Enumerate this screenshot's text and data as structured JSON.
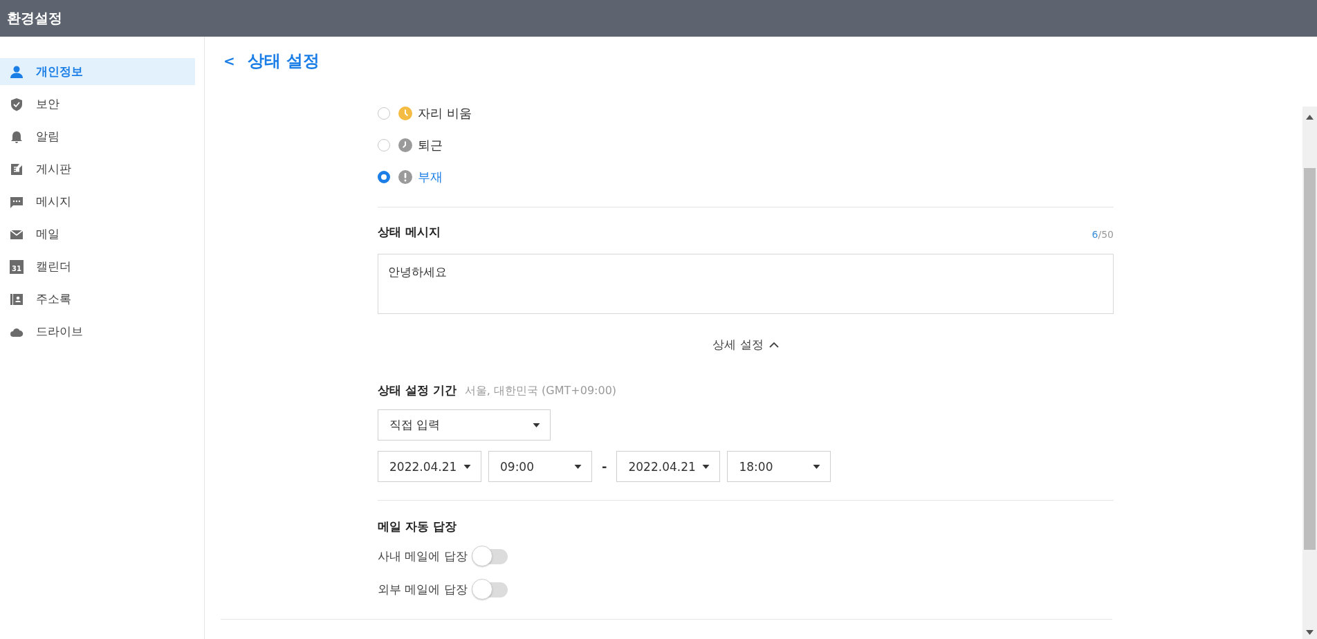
{
  "header": {
    "title": "환경설정"
  },
  "sidebar": {
    "items": [
      {
        "kind": "person",
        "label": "개인정보",
        "selected": true
      },
      {
        "kind": "shield",
        "label": "보안",
        "selected": false
      },
      {
        "kind": "bell",
        "label": "알림",
        "selected": false
      },
      {
        "kind": "board",
        "label": "게시판",
        "selected": false
      },
      {
        "kind": "chat",
        "label": "메시지",
        "selected": false
      },
      {
        "kind": "mail",
        "label": "메일",
        "selected": false
      },
      {
        "kind": "calendar",
        "label": "캘린더",
        "selected": false,
        "icon_text": "31"
      },
      {
        "kind": "contacts",
        "label": "주소록",
        "selected": false
      },
      {
        "kind": "cloud",
        "label": "드라이브",
        "selected": false
      }
    ]
  },
  "page": {
    "back": "<",
    "title": "상태 설정"
  },
  "statuses": [
    {
      "kind": "away",
      "label": "자리 비움",
      "selected": false,
      "color": "#f4bc42"
    },
    {
      "kind": "off",
      "label": "퇴근",
      "selected": false,
      "color": "#9a9a9a"
    },
    {
      "kind": "absent",
      "label": "부재",
      "selected": true,
      "color": "#9a9a9a"
    }
  ],
  "status_message": {
    "title": "상태 메시지",
    "count": "6",
    "limit": "/50",
    "value": "안녕하세요"
  },
  "details_toggle": {
    "label": "상세 설정",
    "expanded": true
  },
  "period": {
    "title": "상태 설정 기간",
    "timezone": "서울, 대한민국 (GMT+09:00)",
    "mode": "직접 입력",
    "start_date": "2022.04.21",
    "start_time": "09:00",
    "separator": "-",
    "end_date": "2022.04.21",
    "end_time": "18:00"
  },
  "auto_reply": {
    "title": "메일 자동 답장",
    "options": [
      {
        "label": "사내 메일에 답장",
        "on": false
      },
      {
        "label": "외부 메일에 답장",
        "on": false
      }
    ]
  }
}
